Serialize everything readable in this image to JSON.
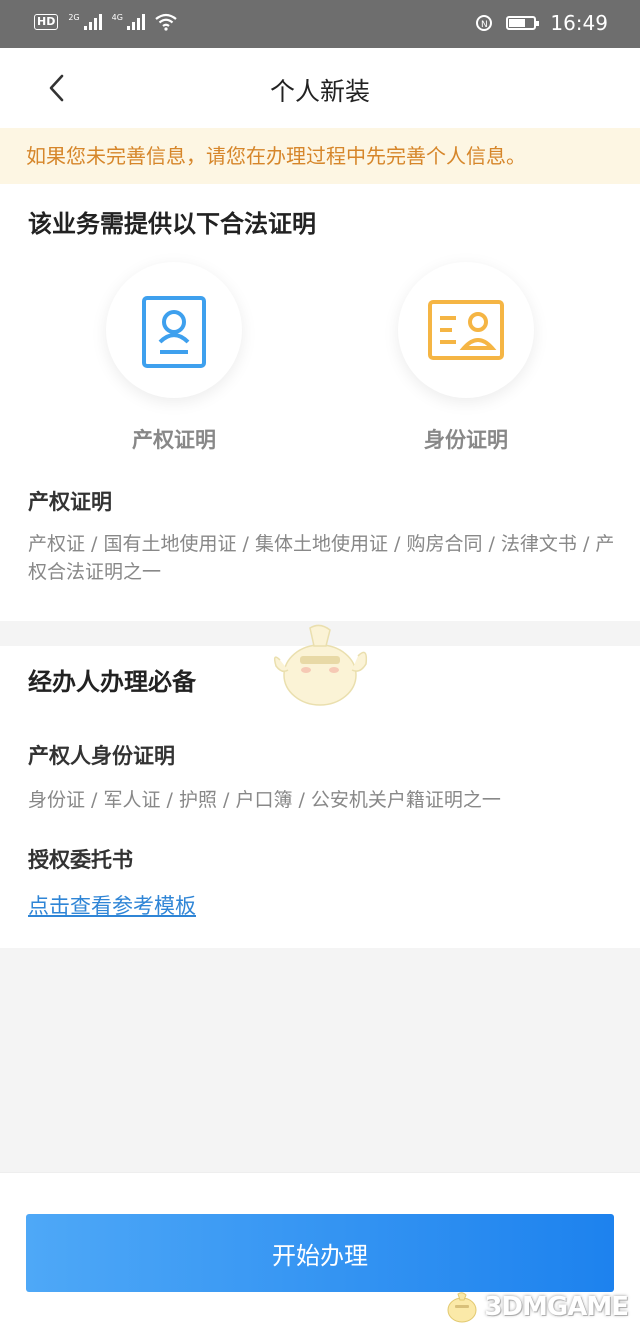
{
  "status_bar": {
    "hd_label": "HD",
    "network_1": "2G",
    "network_2": "4G",
    "nfc_label": "N",
    "time": "16:49"
  },
  "nav": {
    "back_icon": "chevron-left-icon",
    "title": "个人新装"
  },
  "notice": {
    "text": "如果您未完善信息，请您在办理过程中先完善个人信息。"
  },
  "proof_section": {
    "title": "该业务需提供以下合法证明",
    "items": [
      {
        "label": "产权证明",
        "icon": "property-certificate-icon",
        "color": "#3ea0ee"
      },
      {
        "label": "身份证明",
        "icon": "id-card-icon",
        "color": "#f5b544"
      }
    ],
    "detail_title": "产权证明",
    "detail_desc": "产权证 / 国有土地使用证 / 集体土地使用证 / 购房合同 / 法律文书 / 产权合法证明之一"
  },
  "agent_section": {
    "title": "经办人办理必备",
    "owner_id_title": "产权人身份证明",
    "owner_id_desc": "身份证 / 军人证 / 护照 / 户口簿 / 公安机关户籍证明之一",
    "authorization_title": "授权委托书",
    "template_link": "点击查看参考模板"
  },
  "footer": {
    "start_button": "开始办理"
  },
  "watermark": {
    "text": "3DMGAME"
  },
  "colors": {
    "accent": "#2f85d6",
    "notice_text": "#d6862a",
    "notice_bg": "#fdf6e3"
  }
}
